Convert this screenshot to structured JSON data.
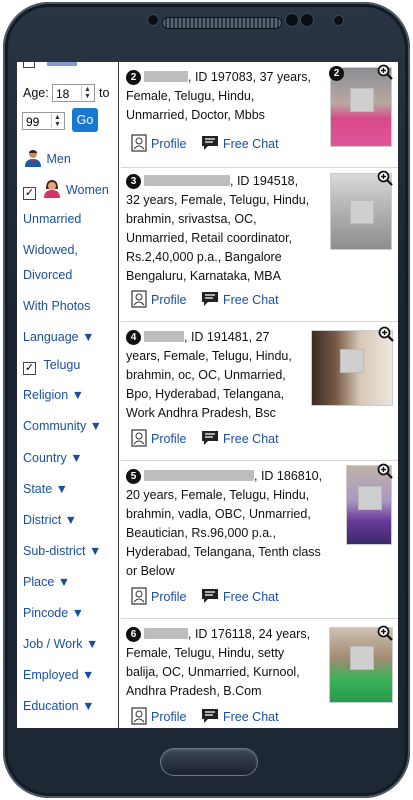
{
  "sidebar": {
    "age_label": "Age:",
    "age_from": "18",
    "to_label": "to",
    "age_to": "99",
    "go_label": "Go",
    "men_label": "Men",
    "women_label": "Women",
    "women_checked": "✓",
    "unmarried": "Unmarried",
    "widowed_1": "Widowed,",
    "widowed_2": "Divorced",
    "with_photos": "With Photos",
    "language": "Language ▼",
    "telugu": "Telugu",
    "telugu_checked": "✓",
    "religion": "Religion ▼",
    "community": "Community ▼",
    "country": "Country ▼",
    "state": "State ▼",
    "district": "District ▼",
    "subdistrict": "Sub-district ▼",
    "place": "Place ▼",
    "pincode": "Pincode ▼",
    "job": "Job / Work ▼",
    "employed": "Employed ▼",
    "education": "Education ▼"
  },
  "actions": {
    "profile": "Profile",
    "chat": "Free Chat"
  },
  "profiles": [
    {
      "num": "2",
      "photo_num": "2",
      "l1": ", ID 197083, 37 years,",
      "l2": "Female, Telugu, Hindu,",
      "l3": "Unmarried, Doctor, Mbbs"
    },
    {
      "num": "3",
      "l1": ", ID 194518,",
      "l2": "32 years, Female, Telugu, Hindu,",
      "l3": "brahmin, srivastsa, OC,",
      "l4": "Unmarried, Retail coordinator,",
      "l5": "Rs.2,40,000 p.a., Bangalore",
      "l6": "Bengaluru, Karnataka, MBA"
    },
    {
      "num": "4",
      "l1": ", ID 191481, 27",
      "l2": "years, Female, Telugu, Hindu,",
      "l3": "brahmin, oc, OC, Unmarried,",
      "l4": "Bpo, Hyderabad, Telangana,",
      "l5": "Work Andhra Pradesh, Bsc"
    },
    {
      "num": "5",
      "l1": ", ID 186810,",
      "l2": "20 years, Female, Telugu, Hindu,",
      "l3": "brahmin, vadla, OBC, Unmarried,",
      "l4": "Beautician, Rs.96,000 p.a.,",
      "l5": "Hyderabad, Telangana, Tenth class",
      "l6": "or Below"
    },
    {
      "num": "6",
      "l1": ", ID 176118, 24 years,",
      "l2": "Female, Telugu, Hindu, setty",
      "l3": "balija, OC, Unmarried, Kurnool,",
      "l4": "Andhra Pradesh, B.Com"
    }
  ]
}
